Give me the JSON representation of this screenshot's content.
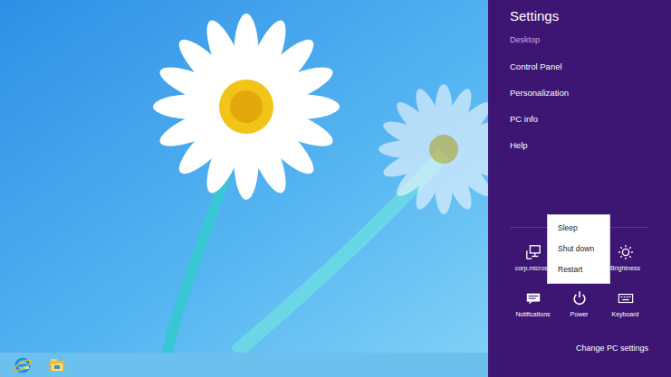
{
  "charm": {
    "title": "Settings",
    "app": "Desktop",
    "items": [
      {
        "label": "Control Panel"
      },
      {
        "label": "Personalization"
      },
      {
        "label": "PC info"
      },
      {
        "label": "Help"
      }
    ]
  },
  "quick_settings": [
    {
      "label": "corp.microsc",
      "kind": "network"
    },
    {
      "label": "Brightness",
      "kind": "brightness"
    },
    {
      "label": "Notifications",
      "kind": "notifications"
    },
    {
      "label": "Power",
      "kind": "power"
    },
    {
      "label": "Keyboard",
      "kind": "keyboard"
    }
  ],
  "power_menu": {
    "items": [
      {
        "label": "Sleep"
      },
      {
        "label": "Shut down"
      },
      {
        "label": "Restart"
      }
    ]
  },
  "footer": "Change PC settings",
  "taskbar": {
    "apps": [
      {
        "kind": "ie"
      },
      {
        "kind": "explorer"
      }
    ]
  }
}
